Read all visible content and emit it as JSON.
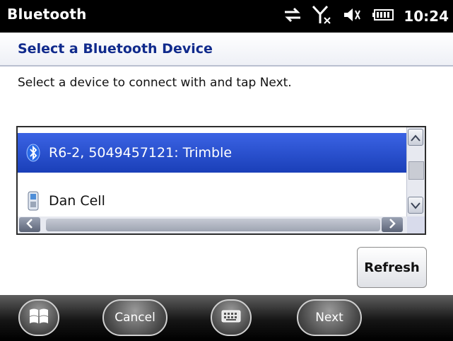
{
  "status_bar": {
    "title": "Bluetooth",
    "time": "10:24",
    "icons": [
      "sync-arrows-icon",
      "signal-off-icon",
      "speaker-muted-icon",
      "battery-icon"
    ]
  },
  "header": {
    "title": "Select a Bluetooth Device"
  },
  "instruction": "Select a device to connect with and tap Next.",
  "devices": [
    {
      "label": "R6-2, 5049457121: Trimble",
      "icon": "bluetooth-icon",
      "selected": true
    },
    {
      "label": "Dan Cell",
      "icon": "phone-icon",
      "selected": false
    }
  ],
  "buttons": {
    "refresh": "Refresh"
  },
  "softkeys": {
    "start": "windows-start-icon",
    "left": "Cancel",
    "keyboard": "keyboard-icon",
    "right": "Next"
  },
  "colors": {
    "selection": "#1f45c4",
    "header_text": "#102a8c"
  }
}
